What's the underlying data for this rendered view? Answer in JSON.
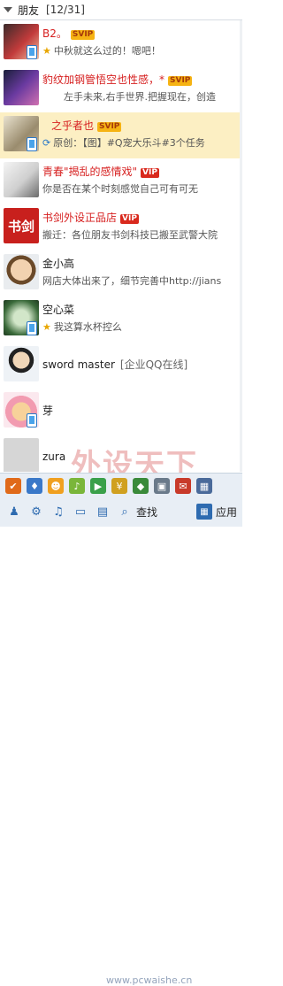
{
  "group": {
    "name": "朋友",
    "count": "[12/31]"
  },
  "contacts": [
    {
      "name": "B2。",
      "badge": "SVIP",
      "sig": "中秋就这么过的！嗯吧！",
      "sig_icon": "★"
    },
    {
      "name": "豹纹加钢管悟空也性感，*",
      "badge": "SVIP",
      "sig": "左手未来,右手世界.把握现在，创造",
      "sig_icon": ""
    },
    {
      "name": "之乎者也",
      "badge": "SVIP",
      "sig": "原创：【图】#Q宠大乐斗#3个任务",
      "sig_icon": "⟳"
    },
    {
      "name": "青春\"揭乱的感情戏\"",
      "badge": "VIP",
      "sig": "你是否在某个时刻感觉自己可有可无",
      "sig_icon": ""
    },
    {
      "name": "书剑外设正品店",
      "badge": "VIP",
      "sig": "搬迁：各位朋友书剑科技已搬至武警大院",
      "sig_icon": ""
    },
    {
      "name": "金小高",
      "badge": "",
      "sig": "网店大体出来了，细节完善中http://jians",
      "sig_icon": ""
    },
    {
      "name": "空心菜",
      "badge": "",
      "sig": "我这算水杯控么",
      "sig_icon": "★"
    },
    {
      "name": "sword master",
      "badge": "",
      "sig": "[企业QQ在线]",
      "sig_icon": ""
    },
    {
      "name": "芽",
      "badge": "",
      "sig": "",
      "sig_icon": ""
    },
    {
      "name": "zura",
      "badge": "",
      "sig": "",
      "sig_icon": ""
    }
  ],
  "bottom": {
    "search_label": "查找",
    "apps_label": "应用"
  },
  "watermark": {
    "title": "外设天下",
    "url": "www.pcwaishe.cn"
  }
}
